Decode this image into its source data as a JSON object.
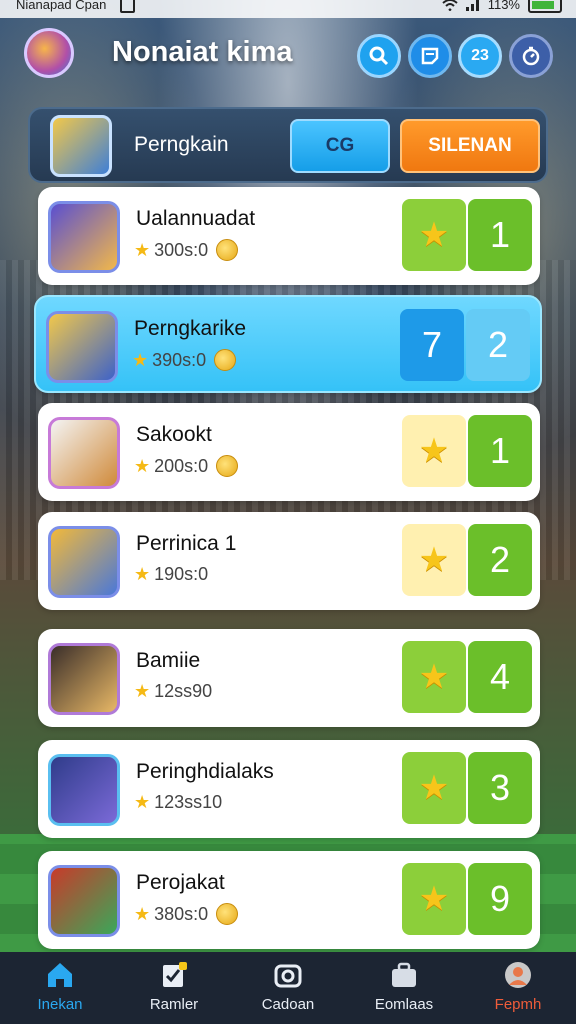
{
  "status_bar": {
    "left_text": "Nianapad Cpan",
    "right_text": "113%"
  },
  "header": {
    "title": "Nonaiat kima",
    "badge_text": "23"
  },
  "top_panel": {
    "player_name": "Perngkain",
    "button_cg": "CG",
    "button_silenan": "SILENAN"
  },
  "rows": [
    {
      "name": "Ualannuadat",
      "score": "300s:0",
      "right_label": "1",
      "style": "green",
      "has_coin": true
    },
    {
      "name": "Perngkarike",
      "score": "390s:0",
      "right_label": "2",
      "left_label": "7",
      "style": "blue",
      "has_coin": true
    },
    {
      "name": "Sakookt",
      "score": "200s:0",
      "right_label": "1",
      "style": "yellow",
      "has_coin": true
    },
    {
      "name": "Perrinica 1",
      "score": "190s:0",
      "right_label": "2",
      "style": "yellow",
      "has_coin": false
    },
    {
      "name": "Bamiie",
      "score": "12ss90",
      "right_label": "4",
      "style": "green",
      "has_coin": false
    },
    {
      "name": "Peringhdialaks",
      "score": "123ss10",
      "right_label": "3",
      "style": "green",
      "has_coin": false
    },
    {
      "name": "Perojakat",
      "score": "380s:0",
      "right_label": "9",
      "style": "green",
      "has_coin": true
    }
  ],
  "nav": {
    "items": [
      {
        "label": "Inekan",
        "icon": "home-icon",
        "active": true
      },
      {
        "label": "Ramler",
        "icon": "checklist-icon"
      },
      {
        "label": "Cadoan",
        "icon": "camera-icon"
      },
      {
        "label": "Eomlaas",
        "icon": "briefcase-icon"
      },
      {
        "label": "Fepmh",
        "icon": "profile-icon"
      }
    ]
  },
  "colors": {
    "accent_blue": "#1fa2ef",
    "accent_orange": "#f07810",
    "accent_green": "#6bbf2a"
  }
}
